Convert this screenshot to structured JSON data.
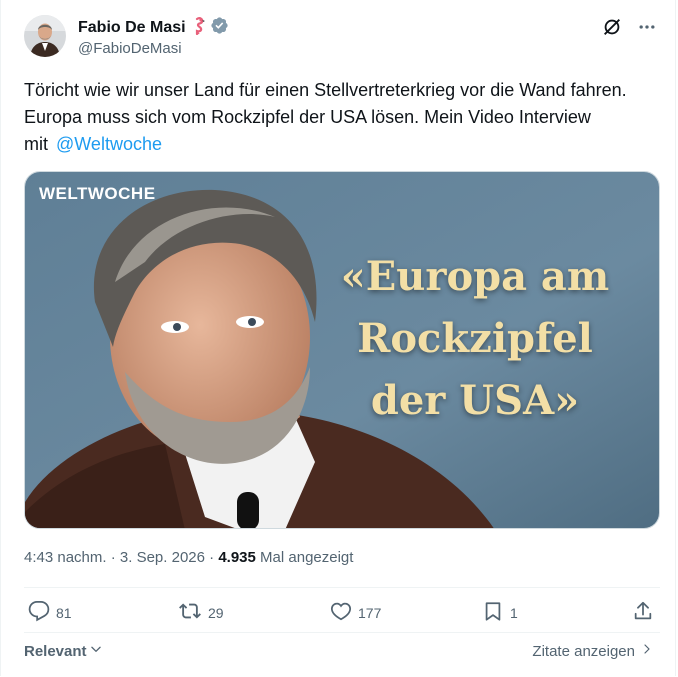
{
  "author": {
    "name": "Fabio De Masi",
    "handle": "@FabioDeMasi",
    "name_emoji_icon": "flamingo-icon",
    "verified_icon": "verified-badge-icon"
  },
  "header_icons": [
    "grok-icon",
    "more-icon"
  ],
  "tweet": {
    "text": "Töricht wie wir unser Land für einen Stellvertreterkrieg vor die Wand fahren. Europa muss sich vom Rockzipfel der USA lösen. Mein Video Interview mit",
    "mention": "@Weltwoche"
  },
  "media": {
    "brand": "WELTWOCHE",
    "headline_lines": [
      "«Europa am",
      "Rockzipfel",
      "der USA»"
    ]
  },
  "meta": {
    "time": "4:43 nachm.",
    "separator": "·",
    "date": "3. Sep. 2026",
    "views": "4.935",
    "views_label": "Mal angezeigt"
  },
  "actions": {
    "replies": "81",
    "retweets": "29",
    "likes": "177",
    "bookmarks": "1"
  },
  "footer": {
    "sort_label": "Relevant",
    "quotes_label": "Zitate anzeigen"
  },
  "colors": {
    "accent": "#1d9bf0",
    "secondary_text": "#536471",
    "headline": "#f3dfa6"
  }
}
